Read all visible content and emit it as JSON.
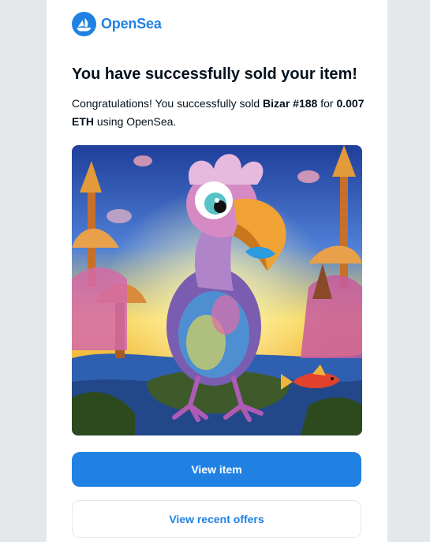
{
  "brand": {
    "name": "OpenSea",
    "color": "#2081e2"
  },
  "email": {
    "heading": "You have successfully sold your item!",
    "intro": "Congratulations! You successfully sold ",
    "item_name": "Bizar #188",
    "mid": " for ",
    "price": "0.007 ETH",
    "outro": " using OpenSea."
  },
  "image": {
    "subject": "nft-artwork-bird-creature"
  },
  "actions": {
    "view_item_label": "View item",
    "view_offers_label": "View recent offers"
  }
}
